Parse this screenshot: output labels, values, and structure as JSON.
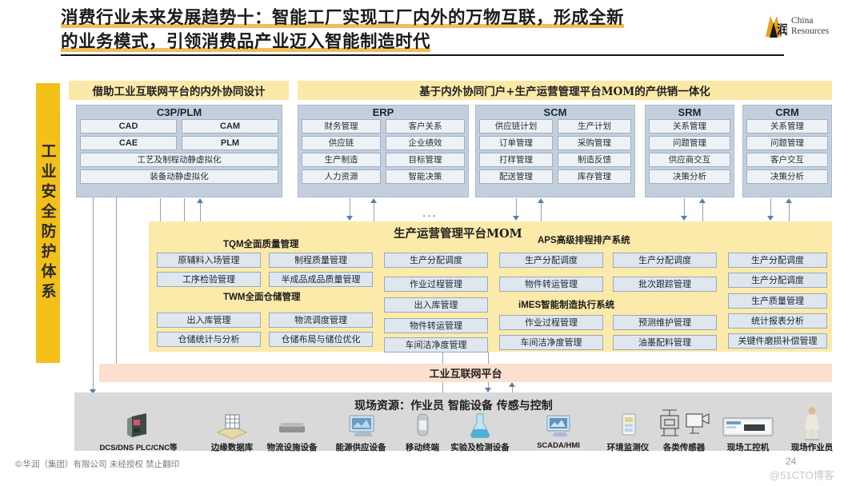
{
  "slide": {
    "title_line1": "消费行业未来发展趋势十：智能工厂实现工厂内外的万物互联，形成全新",
    "title_line2": "的业务模式，引领消费品产业迈入智能制造时代",
    "page_number": "24",
    "copyright": "©华润（集团）有限公司  未经授权 禁止翻印",
    "watermark": "@51CTO博客"
  },
  "logo": {
    "line1": "China",
    "line2": "Resources"
  },
  "safety_band": {
    "label": "工业安全防护体系"
  },
  "headers": {
    "design": "借助工业互联网平台的内外协同设计",
    "psm": "基于内外协同门户+生产运营管理平台MOM的产供销一体化"
  },
  "panels": [
    {
      "id": "c3p",
      "title": "C3P/PLM",
      "grid_cells": [
        "CAD",
        "CAM",
        "CAE",
        "PLM"
      ],
      "full_cells": [
        "工艺及制程动静虚拟化",
        "装备动静虚拟化"
      ]
    },
    {
      "id": "erp",
      "title": "ERP",
      "grid_cells": [
        "财务管理",
        "客户关系",
        "供应链",
        "企业绩效",
        "生产制造",
        "目标管理",
        "人力资源",
        "智能决策"
      ],
      "full_cells": []
    },
    {
      "id": "scm",
      "title": "SCM",
      "grid_cells": [
        "供应链计划",
        "生产计划",
        "订单管理",
        "采购管理",
        "打样管理",
        "制造反馈",
        "配送管理",
        "库存管理"
      ],
      "full_cells": []
    },
    {
      "id": "srm",
      "title": "SRM",
      "grid_cells": [],
      "full_cells": [
        "关系管理",
        "问题管理",
        "供应商交互",
        "决策分析"
      ]
    },
    {
      "id": "crm",
      "title": "CRM",
      "grid_cells": [],
      "full_cells": [
        "关系管理",
        "问题管理",
        "客户交互",
        "决策分析"
      ]
    }
  ],
  "mom": {
    "title": "生产运营管理平台MOM",
    "ellipsis": "...",
    "sections": {
      "tqm": "TQM全面质量管理",
      "twm": "TWM全面仓储管理",
      "aps": "APS高级排程排产系统",
      "imes": "iMES智能制造执行系统"
    },
    "cells": {
      "tqm": [
        "原辅料入场管理",
        "制程质量管理",
        "工序检验管理",
        "半成品成品质量管理"
      ],
      "twm": [
        "出入库管理",
        "物流调度管理",
        "仓储统计与分析",
        "仓储布局与储位优化"
      ],
      "aps": [
        "生产分配调度",
        "生产分配调度",
        "物件转运管理",
        "批次跟踪管理"
      ],
      "imes": [
        "作业过程管理",
        "预测维护管理",
        "车间洁净度管理",
        "油墨配料管理"
      ],
      "right": [
        "生产分配调度",
        "生产分配调度",
        "生产质量管理",
        "统计报表分析",
        "关键件磨损补偿管理"
      ]
    }
  },
  "iip": {
    "label": "工业互联网平台"
  },
  "resources": {
    "title": "现场资源：作业员 智能设备 传感与控制",
    "items": [
      {
        "icon": "dcs-controller-icon",
        "label": "DCS/DNS PLC/CNC等",
        "latin": true
      },
      {
        "icon": "edge-database-icon",
        "label": "边缘数据库",
        "latin": false
      },
      {
        "icon": "logistics-equipment-icon",
        "label": "物流设施设备",
        "latin": false
      },
      {
        "icon": "energy-supply-icon",
        "label": "能源供应设备",
        "latin": false
      },
      {
        "icon": "mobile-terminal-icon",
        "label": "移动终端",
        "latin": false
      },
      {
        "icon": "lab-testing-icon",
        "label": "实验及检测设备",
        "latin": false
      },
      {
        "icon": "scada-hmi-icon",
        "label": "SCADA/HMI",
        "latin": true
      },
      {
        "icon": "environment-monitor-icon",
        "label": "环境监测仪",
        "latin": false
      },
      {
        "icon": "sensors-icon",
        "label": "各类传感器",
        "latin": false
      },
      {
        "icon": "industrial-pc-icon",
        "label": "现场工控机",
        "latin": false
      },
      {
        "icon": "field-operator-icon",
        "label": "现场作业员",
        "latin": false
      }
    ]
  },
  "colors": {
    "brand_yellow": "#f2c018",
    "header_yellow": "#fbe9a8",
    "panel_blue": "#c3cfdd",
    "cell_blue": "#eef2f6",
    "mom_yellow": "#fbeaa9",
    "iip_peach": "#fbe0cf",
    "strip_gray": "#d9d9d9"
  }
}
